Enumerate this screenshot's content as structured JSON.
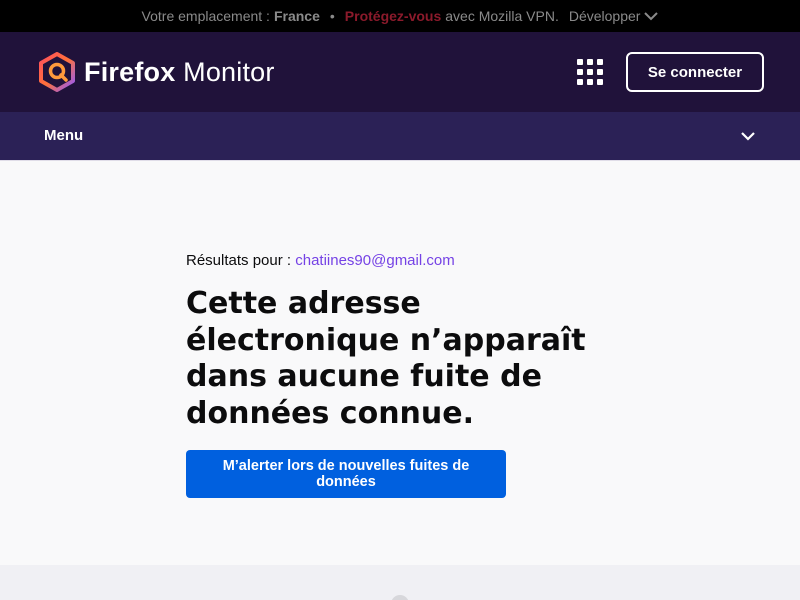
{
  "top_banner": {
    "location_label": "Votre emplacement :",
    "country": "France",
    "separator": "•",
    "protect_link": "Protégez-vous",
    "vpn_text": "avec Mozilla VPN.",
    "develop_label": "Développer"
  },
  "header": {
    "logo_bold": "Firefox",
    "logo_regular": "Monitor",
    "signin_label": "Se connecter",
    "apps_icon": "grid-icon"
  },
  "menu": {
    "label": "Menu",
    "icon": "chevron-down-icon"
  },
  "main": {
    "results_prefix": "Résultats pour :",
    "email": "chatiines90@gmail.com",
    "headline": "Cette adresse électronique n’apparaît dans aucune fuite de données connue.",
    "alert_button": "M’alerter lors de nouvelles fuites de données"
  },
  "colors": {
    "header_bg": "#20123a",
    "menu_bg": "#2b2156",
    "email_link": "#7542e5",
    "primary_button": "#0060df",
    "protect_link": "#8b1a2b"
  }
}
